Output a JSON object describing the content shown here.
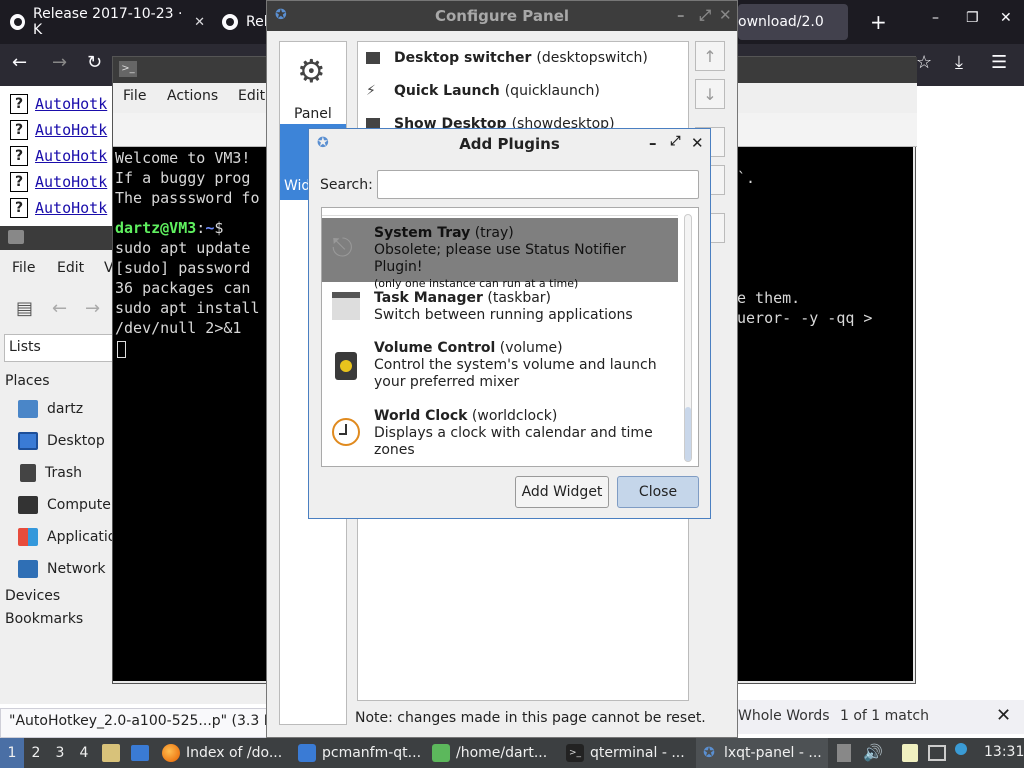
{
  "browser": {
    "tabs": [
      {
        "label": "Release 2017-10-23 · K"
      },
      {
        "label": "Rel"
      },
      {
        "label": "ownload/2.0"
      }
    ],
    "tab_close": "✕",
    "new_tab": "+",
    "ahk_links": [
      "AutoHotk",
      "AutoHotk",
      "AutoHotk",
      "AutoHotk",
      "AutoHotk"
    ],
    "status_url": "\"AutoHotkey_2.0-a100-525...p\" (3.3 M",
    "findbar": {
      "whole_words": "Whole Words",
      "match_count": "1 of 1 match"
    }
  },
  "pcmanfm": {
    "menu": [
      "File",
      "Edit",
      "V"
    ],
    "location": "Lists",
    "places_header": "Places",
    "places": [
      "dartz",
      "Desktop",
      "Trash",
      "Compute",
      "Applicatio",
      "Network"
    ],
    "devices_header": "Devices",
    "bookmarks_header": "Bookmarks"
  },
  "qterminal": {
    "menu": [
      "File",
      "Actions",
      "Edit"
    ],
    "lines": {
      "l1": "Welcome to VM3!",
      "l2": "If a buggy prog",
      "l3": "The passsword fo",
      "prompt_user": "dartz@VM3",
      "prompt_colon": ":",
      "prompt_path": "~",
      "prompt_dollar": "$",
      "l5": "sudo apt update",
      "l6": "[sudo] password",
      "l7": "36 packages can",
      "l8": "sudo apt install",
      "l9": "/dev/null 2>&1",
      "r1": "`.",
      "r2": "e them.",
      "r3": "ueror- -y -qq >"
    }
  },
  "configure_panel": {
    "title": "Configure Panel",
    "sidebar": [
      {
        "label": "Panel"
      },
      {
        "label": "Wid"
      }
    ],
    "widgets": [
      {
        "name": "Desktop switcher",
        "id": "(desktopswitch)"
      },
      {
        "name": "Quick Launch",
        "id": "(quicklaunch)"
      },
      {
        "name": "Show Desktop",
        "id": "(showdesktop)"
      }
    ],
    "note": "Note: changes made in this page cannot be reset."
  },
  "add_plugins": {
    "title": "Add Plugins",
    "search_label": "Search:",
    "search_value": "",
    "plugins": [
      {
        "name": "System Tray",
        "id": "(tray)",
        "desc": "Obsolete; please use Status Notifier Plugin!",
        "note": "(only one instance can run at a time)"
      },
      {
        "name": "Task Manager",
        "id": "(taskbar)",
        "desc": "Switch between running applications"
      },
      {
        "name": "Volume Control",
        "id": "(volume)",
        "desc": "Control the system's volume and launch",
        "desc2": "your preferred mixer"
      },
      {
        "name": "World Clock",
        "id": "(worldclock)",
        "desc": "Displays a clock with calendar and time",
        "desc2": "zones"
      }
    ],
    "add_button": "Add Widget",
    "close_button": "Close"
  },
  "taskbar": {
    "desktops": [
      "1",
      "2",
      "3",
      "4"
    ],
    "tasks": [
      {
        "label": "Index of /do..."
      },
      {
        "label": "pcmanfm-qt..."
      },
      {
        "label": "/home/dart..."
      },
      {
        "label": "qterminal - ..."
      },
      {
        "label": "lxqt-panel - ..."
      }
    ],
    "clock": "13:31"
  },
  "colors": {
    "accent": "#4a7fc1",
    "selection": "#7f7f7f",
    "terminal_bg": "#000000",
    "taskbar_bg": "#3c3f41"
  }
}
